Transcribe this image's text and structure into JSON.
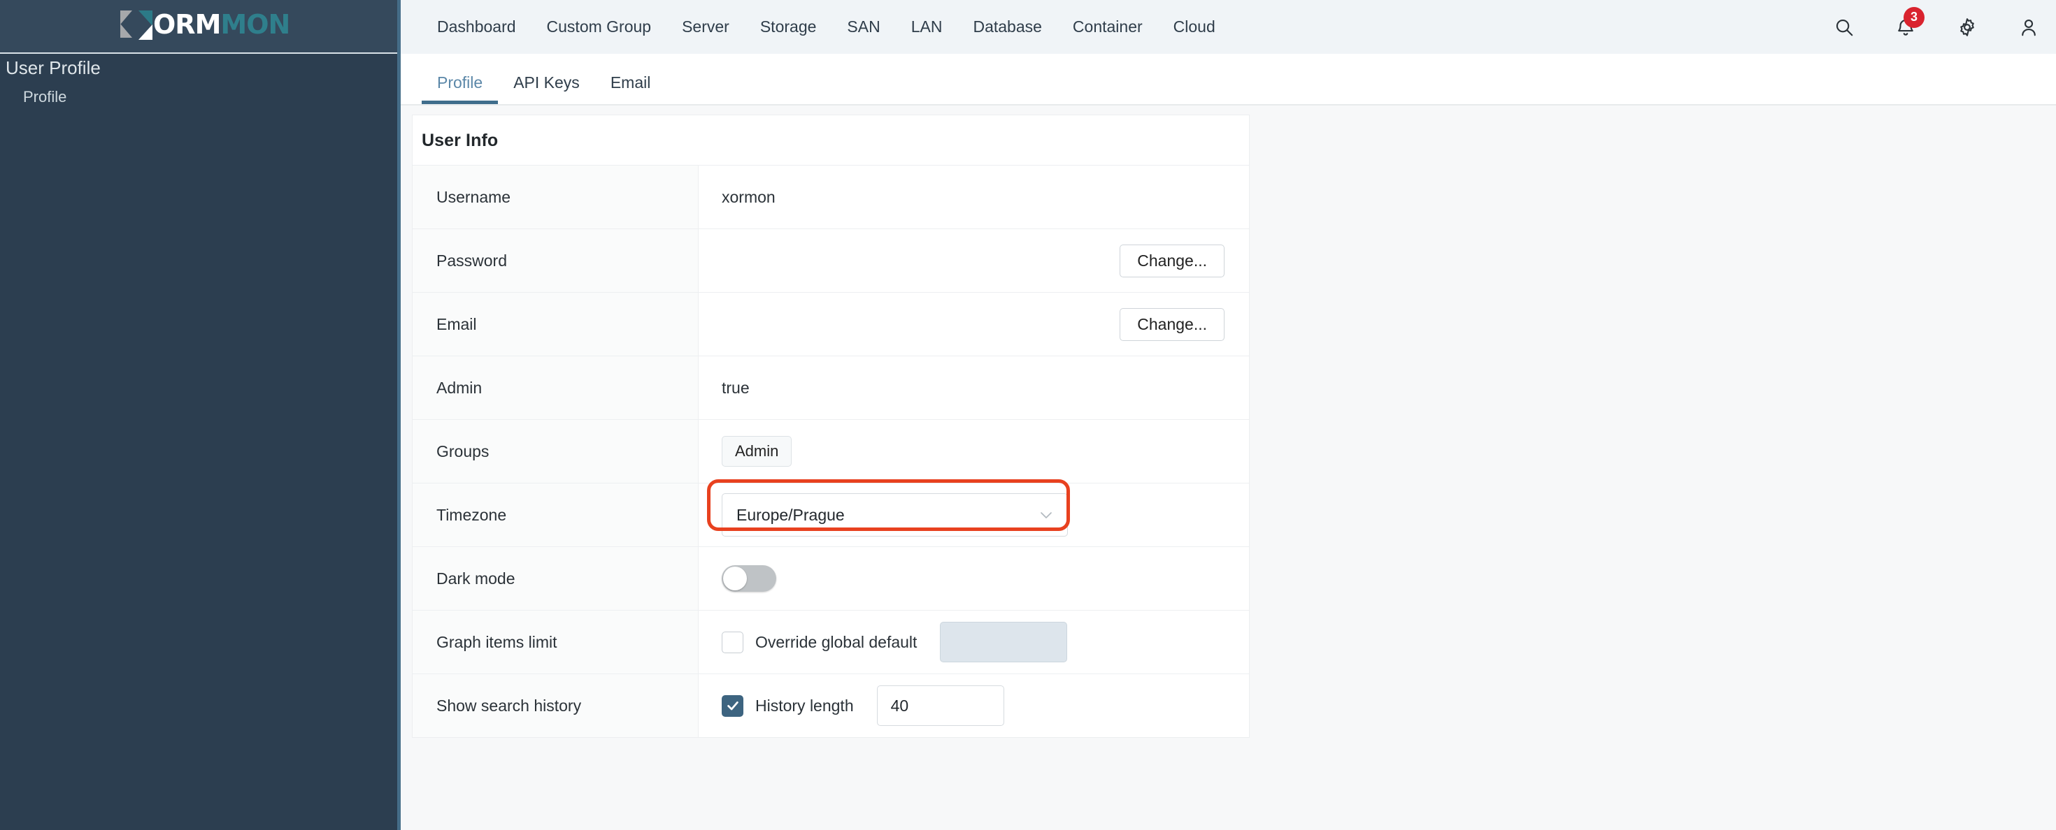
{
  "brand": {
    "logo_prefix": "X",
    "logo_mid": "ORM",
    "logo_suffix": "MON"
  },
  "sidebar": {
    "title": "User Profile",
    "items": [
      {
        "label": "Profile"
      }
    ]
  },
  "topnav": {
    "items": [
      {
        "label": "Dashboard"
      },
      {
        "label": "Custom Group"
      },
      {
        "label": "Server"
      },
      {
        "label": "Storage"
      },
      {
        "label": "SAN"
      },
      {
        "label": "LAN"
      },
      {
        "label": "Database"
      },
      {
        "label": "Container"
      },
      {
        "label": "Cloud"
      }
    ],
    "icons": {
      "search": "search-icon",
      "notifications": "bell-icon",
      "settings": "gear-icon",
      "account": "user-icon"
    },
    "notification_count": "3",
    "badge_color": "#d9232e"
  },
  "tabs": [
    {
      "label": "Profile",
      "active": true
    },
    {
      "label": "API Keys",
      "active": false
    },
    {
      "label": "Email",
      "active": false
    }
  ],
  "panel": {
    "title": "User Info",
    "rows": {
      "username": {
        "label": "Username",
        "value": "xormon"
      },
      "password": {
        "label": "Password",
        "button": "Change..."
      },
      "email": {
        "label": "Email",
        "button": "Change..."
      },
      "admin": {
        "label": "Admin",
        "value": "true"
      },
      "groups": {
        "label": "Groups",
        "chip": "Admin"
      },
      "timezone": {
        "label": "Timezone",
        "value": "Europe/Prague",
        "chevron": "chevron-down-icon",
        "highlight_color": "#e8411f"
      },
      "dark_mode": {
        "label": "Dark mode",
        "enabled": false
      },
      "graph_items_limit": {
        "label": "Graph items limit",
        "checkbox_label": "Override global default",
        "checked": false,
        "input_value": "",
        "input_disabled": true
      },
      "show_search_history": {
        "label": "Show search history",
        "checkbox_label": "History length",
        "checked": true,
        "input_value": "40",
        "input_disabled": false
      }
    }
  },
  "theme": {
    "sidebar_bg": "#2c3e50",
    "sidebar_edge": "#456d88",
    "header_bg": "#f0f4f7",
    "accent": "#3f6d8c",
    "content_bg": "#f7f8f9"
  }
}
